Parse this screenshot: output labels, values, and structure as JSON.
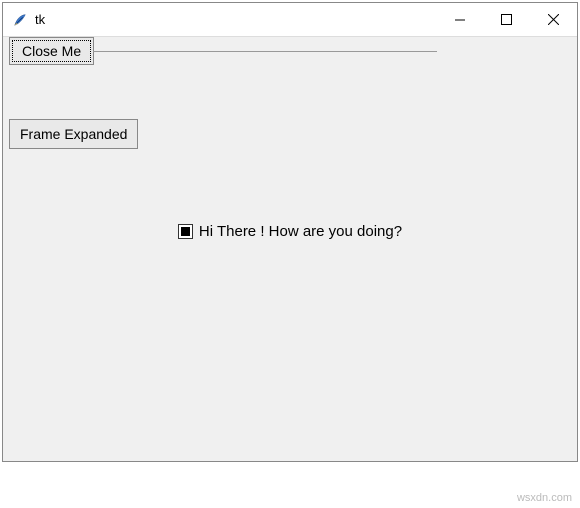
{
  "window": {
    "title": "tk"
  },
  "buttons": {
    "close_me": "Close Me",
    "frame_expanded": "Frame Expanded"
  },
  "checkbox": {
    "label": "Hi There ! How are you doing?",
    "state": "tristate"
  },
  "watermark": "wsxdn.com"
}
